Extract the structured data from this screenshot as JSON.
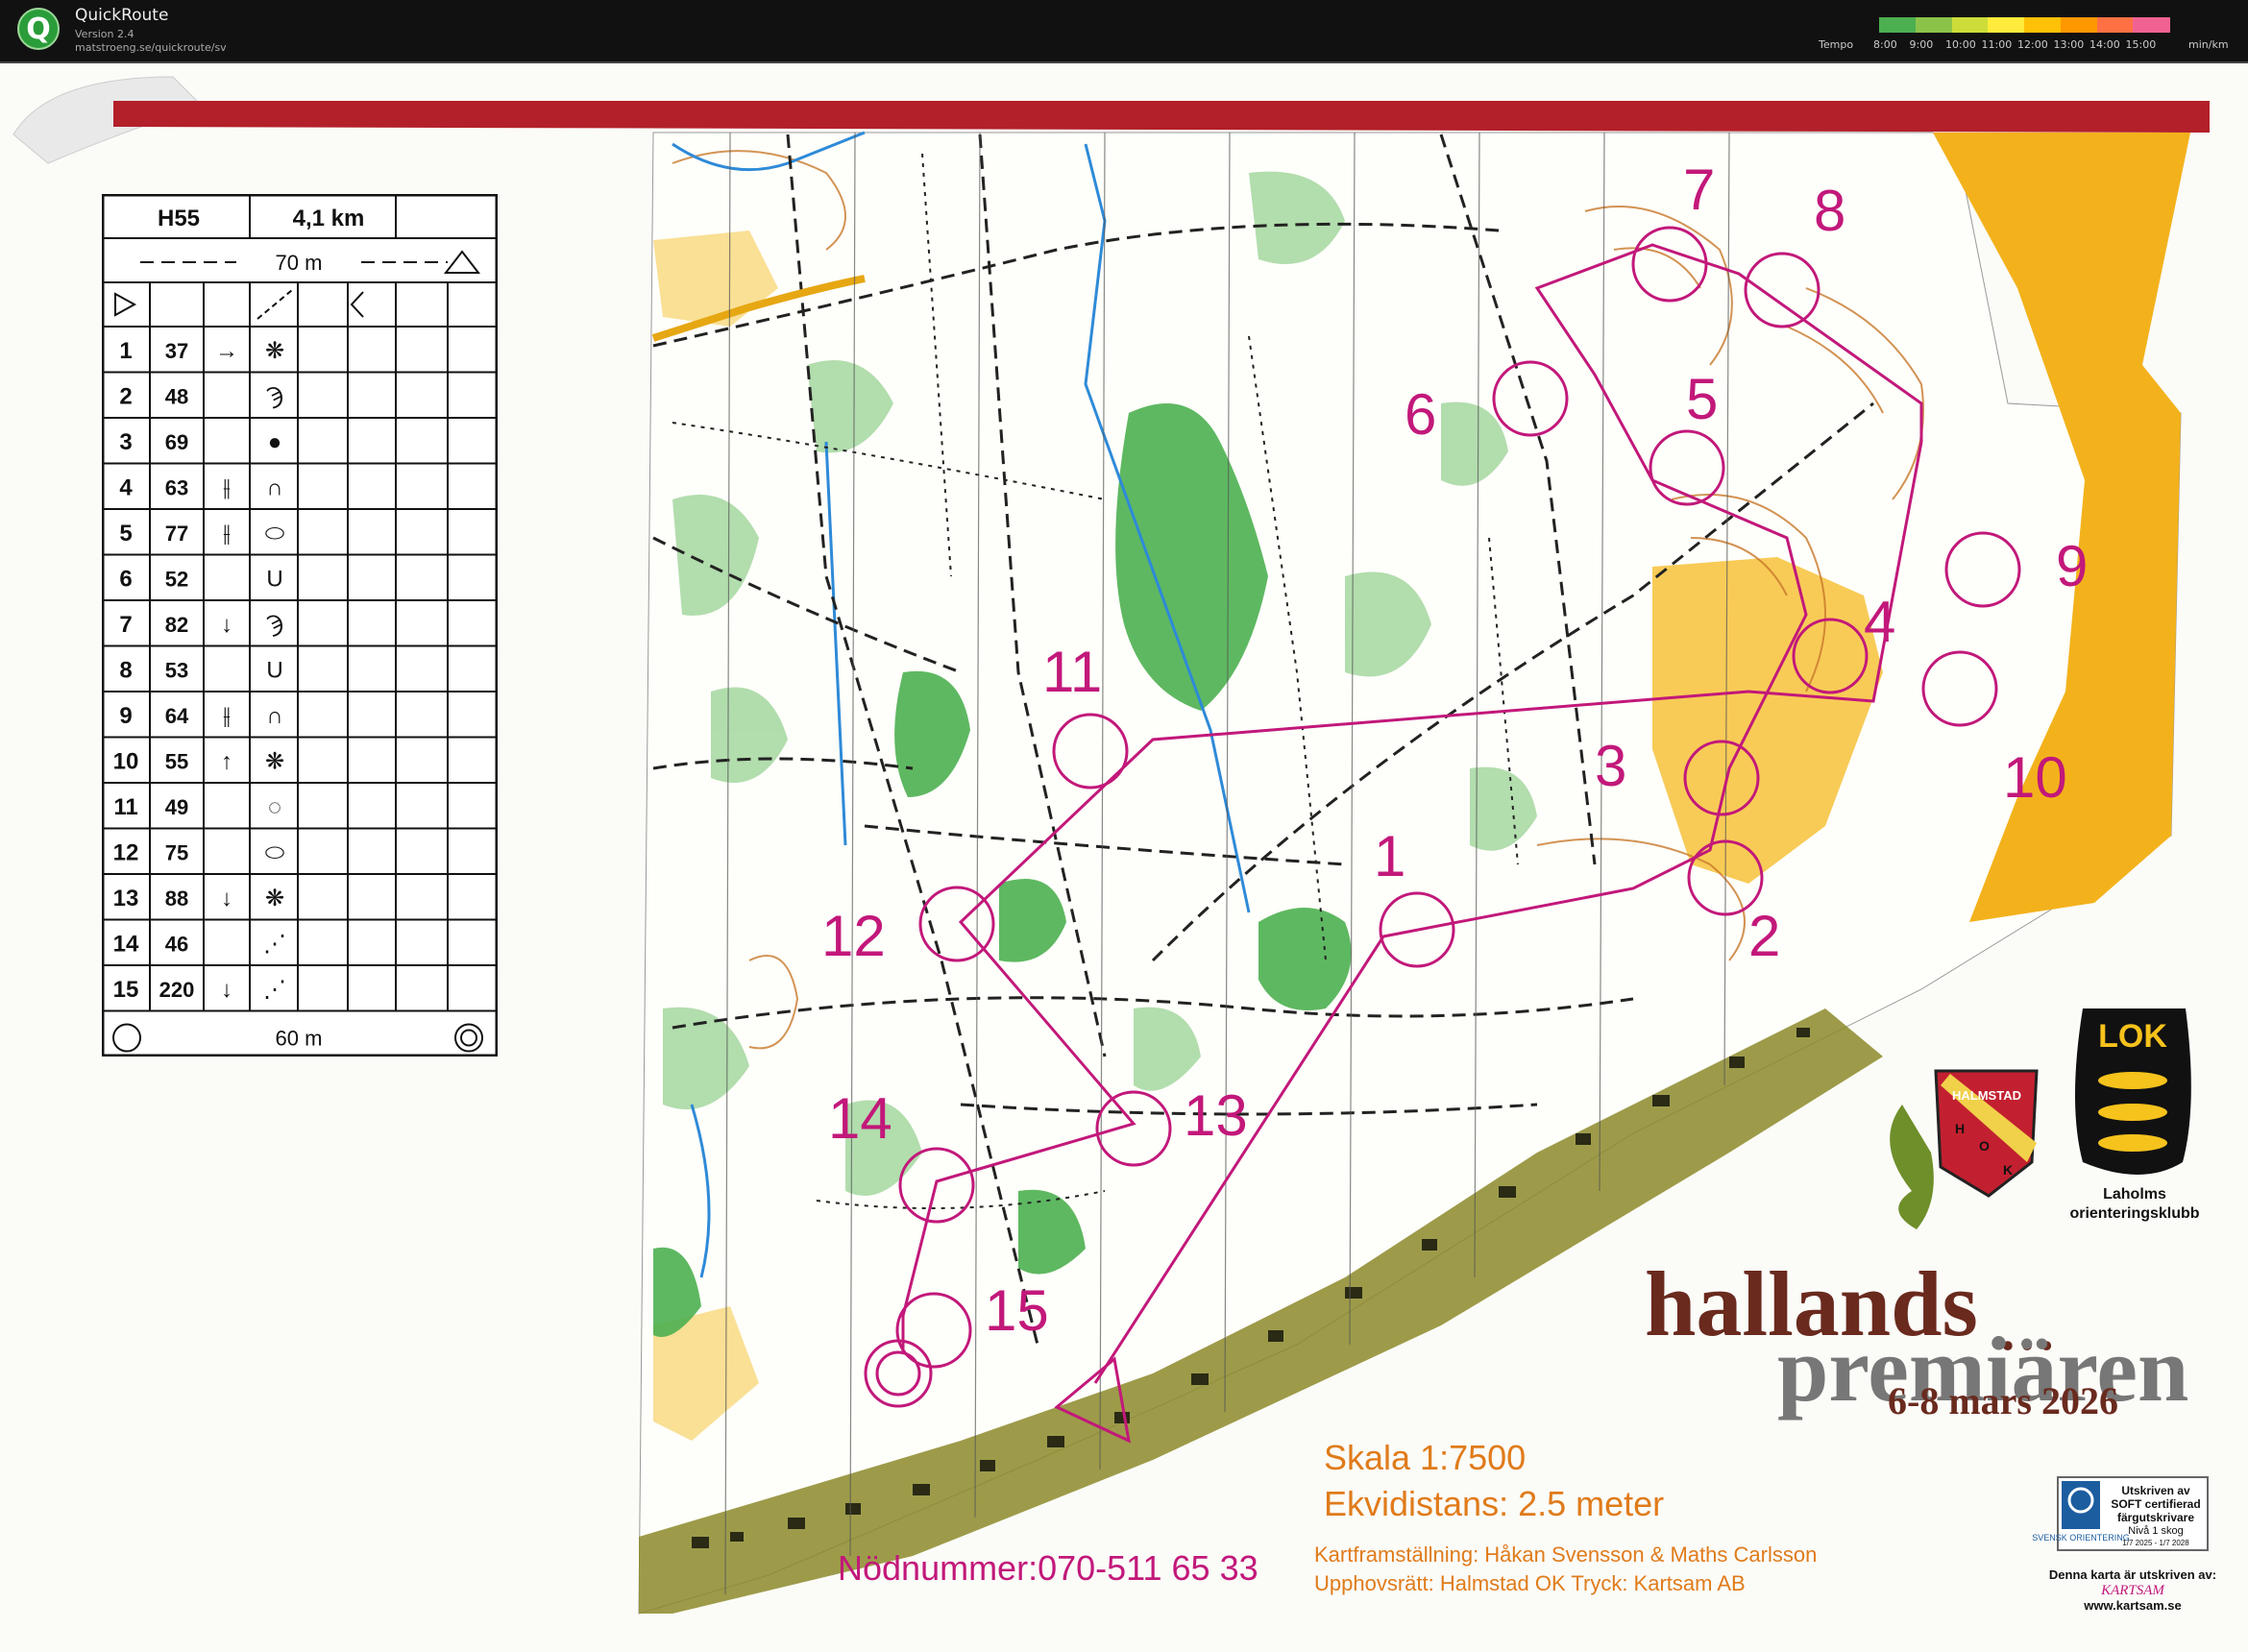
{
  "app": {
    "title": "QuickRoute",
    "version": "Version 2.4",
    "url": "matstroeng.se/quickroute/sv",
    "logo_letter": "Q"
  },
  "tempo_legend": {
    "label": "Tempo",
    "ticks": [
      "8:00",
      "9:00",
      "10:00",
      "11:00",
      "12:00",
      "13:00",
      "14:00",
      "15:00"
    ],
    "unit": "min/km",
    "colors": [
      "#4caf50",
      "#8bc34a",
      "#cddc39",
      "#ffeb3b",
      "#ffc107",
      "#ff9800",
      "#ff7043",
      "#f06292"
    ]
  },
  "course": {
    "class": "H55",
    "length": "4,1 km",
    "start_taping": "70 m",
    "finish_taping": "60 m",
    "controls": [
      {
        "n": "1",
        "code": "37",
        "dir": "→",
        "feature": "❋"
      },
      {
        "n": "2",
        "code": "48",
        "dir": "",
        "feature": "Ϡ"
      },
      {
        "n": "3",
        "code": "69",
        "dir": "",
        "feature": "●"
      },
      {
        "n": "4",
        "code": "63",
        "dir": "⫲",
        "feature": "∩"
      },
      {
        "n": "5",
        "code": "77",
        "dir": "⫲",
        "feature": "⬭"
      },
      {
        "n": "6",
        "code": "52",
        "dir": "",
        "feature": "U"
      },
      {
        "n": "7",
        "code": "82",
        "dir": "↓",
        "feature": "Ϡ"
      },
      {
        "n": "8",
        "code": "53",
        "dir": "",
        "feature": "U"
      },
      {
        "n": "9",
        "code": "64",
        "dir": "⫲",
        "feature": "∩"
      },
      {
        "n": "10",
        "code": "55",
        "dir": "↑",
        "feature": "❋"
      },
      {
        "n": "11",
        "code": "49",
        "dir": "",
        "feature": "◌"
      },
      {
        "n": "12",
        "code": "75",
        "dir": "",
        "feature": "⬭"
      },
      {
        "n": "13",
        "code": "88",
        "dir": "↓",
        "feature": "❋"
      },
      {
        "n": "14",
        "code": "46",
        "dir": "",
        "feature": "⋰"
      },
      {
        "n": "15",
        "code": "220",
        "dir": "↓",
        "feature": "⋰"
      }
    ]
  },
  "map": {
    "control_labels": [
      "1",
      "2",
      "3",
      "4",
      "5",
      "6",
      "7",
      "8",
      "9",
      "10",
      "11",
      "12",
      "13",
      "14",
      "15"
    ],
    "event_title_line1": "hallands",
    "event_title_dots": "…",
    "event_title_line2": "premiären",
    "event_dates": "6-8 mars 2026",
    "scale": "Skala 1:7500",
    "contour": "Ekvidistans: 2.5 meter",
    "emergency": "Nödnummer:070-511 65 33",
    "credits_line1": "Kartframställning: Håkan Svensson & Maths Carlsson",
    "credits_line2": "Upphovsrätt: Halmstad OK  Tryck: Kartsam AB",
    "club_logo_left": "HALMSTAD",
    "club_logo_letters": [
      "H",
      "O",
      "K"
    ],
    "club_logo_right_text": "LOK",
    "club_right_name_1": "Laholms",
    "club_right_name_2": "orienteringsklubb",
    "soft_badge_title": "Utskriven av",
    "soft_badge_line2": "SOFT certifierad",
    "soft_badge_line3": "färgutskrivare",
    "soft_badge_line4": "Nivå 1 skog",
    "soft_badge_line5": "1/7 2025 - 1/7 2028",
    "soft_badge_org": "SVENSK ORIENTERING",
    "printer_line1": "Denna karta är utskriven av:",
    "printer_logo": "KARTSAM",
    "printer_url": "www.kartsam.se"
  },
  "colors": {
    "course_magenta": "#c2187a",
    "border_red": "#b3202a",
    "map_green": "#3aa84a",
    "map_yellow": "#f6b41a",
    "map_brown": "#b5651d",
    "settlement": "#8c8a2a",
    "title_brown": "#6a2a1e",
    "title_gray": "#777",
    "scale_orange": "#e07b1a"
  }
}
